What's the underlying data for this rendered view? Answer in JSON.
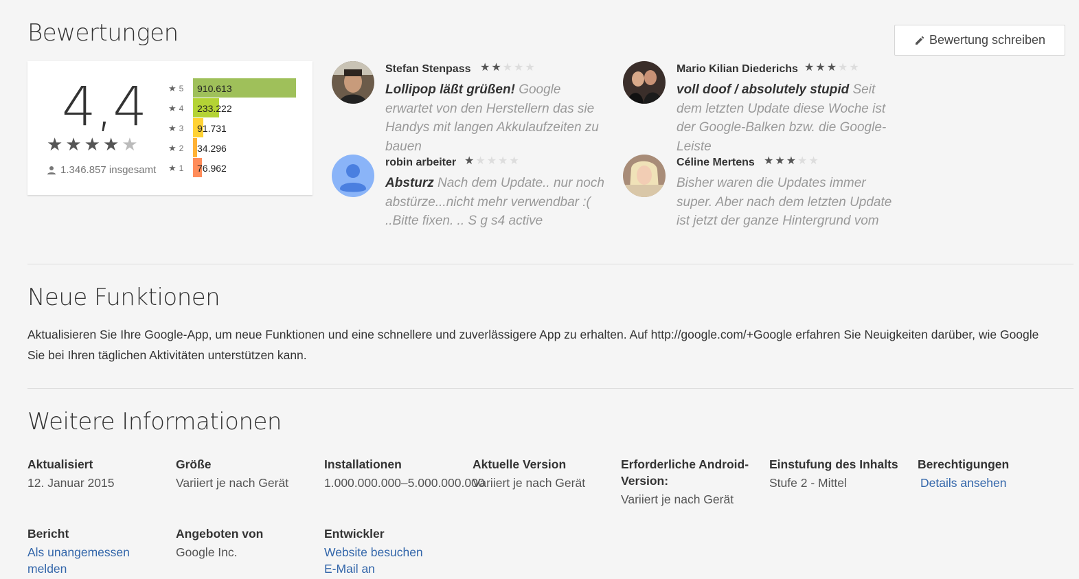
{
  "ratings": {
    "heading": "Bewertungen",
    "write_button": "Bewertung schreiben",
    "score": "4,4",
    "total": "1.346.857 insgesamt",
    "distribution": [
      {
        "stars": "5",
        "count": "910.613",
        "value": 910613,
        "color": "#9fc05a"
      },
      {
        "stars": "4",
        "count": "233.222",
        "value": 233222,
        "color": "#b4d335"
      },
      {
        "stars": "3",
        "count": "91.731",
        "value": 91731,
        "color": "#ffd234"
      },
      {
        "stars": "2",
        "count": "34.296",
        "value": 34296,
        "color": "#ffb235"
      },
      {
        "stars": "1",
        "count": "76.962",
        "value": 76962,
        "color": "#ff8c5a"
      }
    ]
  },
  "reviews": [
    {
      "name": "Stefan Stenpass",
      "stars": 2,
      "title": "Lollipop läßt grüßen!",
      "text": " Google erwartet von den Herstellern das sie Handys mit langen Akkulaufzeiten zu bauen"
    },
    {
      "name": "Mario Kilian Diederichs",
      "stars": 3,
      "title": "voll doof / absolutely stupid",
      "text": " Seit dem letzten Update diese Woche ist der Google-Balken bzw. die Google-Leiste"
    },
    {
      "name": "robin arbeiter",
      "stars": 1,
      "title": "Absturz",
      "text": " Nach dem Update.. nur noch abstürze...nicht mehr verwendbar :( ..Bitte fixen. .. S g s4 active"
    },
    {
      "name": "Céline Mertens",
      "stars": 3,
      "title": "",
      "text": "Bisher waren die Updates immer super. Aber nach dem letzten Update ist jetzt der ganze Hintergrund vom"
    }
  ],
  "whats_new": {
    "heading": "Neue Funktionen",
    "text": "Aktualisieren Sie Ihre Google-App, um neue Funktionen und eine schnellere und zuverlässigere App zu erhalten. Auf http://google.com/+Google erfahren Sie Neuigkeiten darüber, wie Google Sie bei Ihren täglichen Aktivitäten unterstützen kann."
  },
  "more_info": {
    "heading": "Weitere Informationen",
    "updated": {
      "title": "Aktualisiert",
      "value": "12. Januar 2015"
    },
    "size": {
      "title": "Größe",
      "value": "Variiert je nach Gerät"
    },
    "installs": {
      "title": "Installationen",
      "value": "1.000.000.000–5.000.000.000"
    },
    "version": {
      "title": "Aktuelle Version",
      "value": "Variiert je nach Gerät"
    },
    "android": {
      "title": "Erforderliche Android-Version:",
      "value": "Variiert je nach Gerät"
    },
    "rating": {
      "title": "Einstufung des Inhalts",
      "value": "Stufe 2 - Mittel"
    },
    "permissions": {
      "title": "Berechtigungen",
      "link": "Details ansehen"
    },
    "report": {
      "title": "Bericht",
      "link": "Als unangemessen melden"
    },
    "offered": {
      "title": "Angeboten von",
      "value": "Google Inc."
    },
    "developer": {
      "title": "Entwickler",
      "link1": "Website besuchen",
      "link2": "E-Mail an"
    }
  }
}
